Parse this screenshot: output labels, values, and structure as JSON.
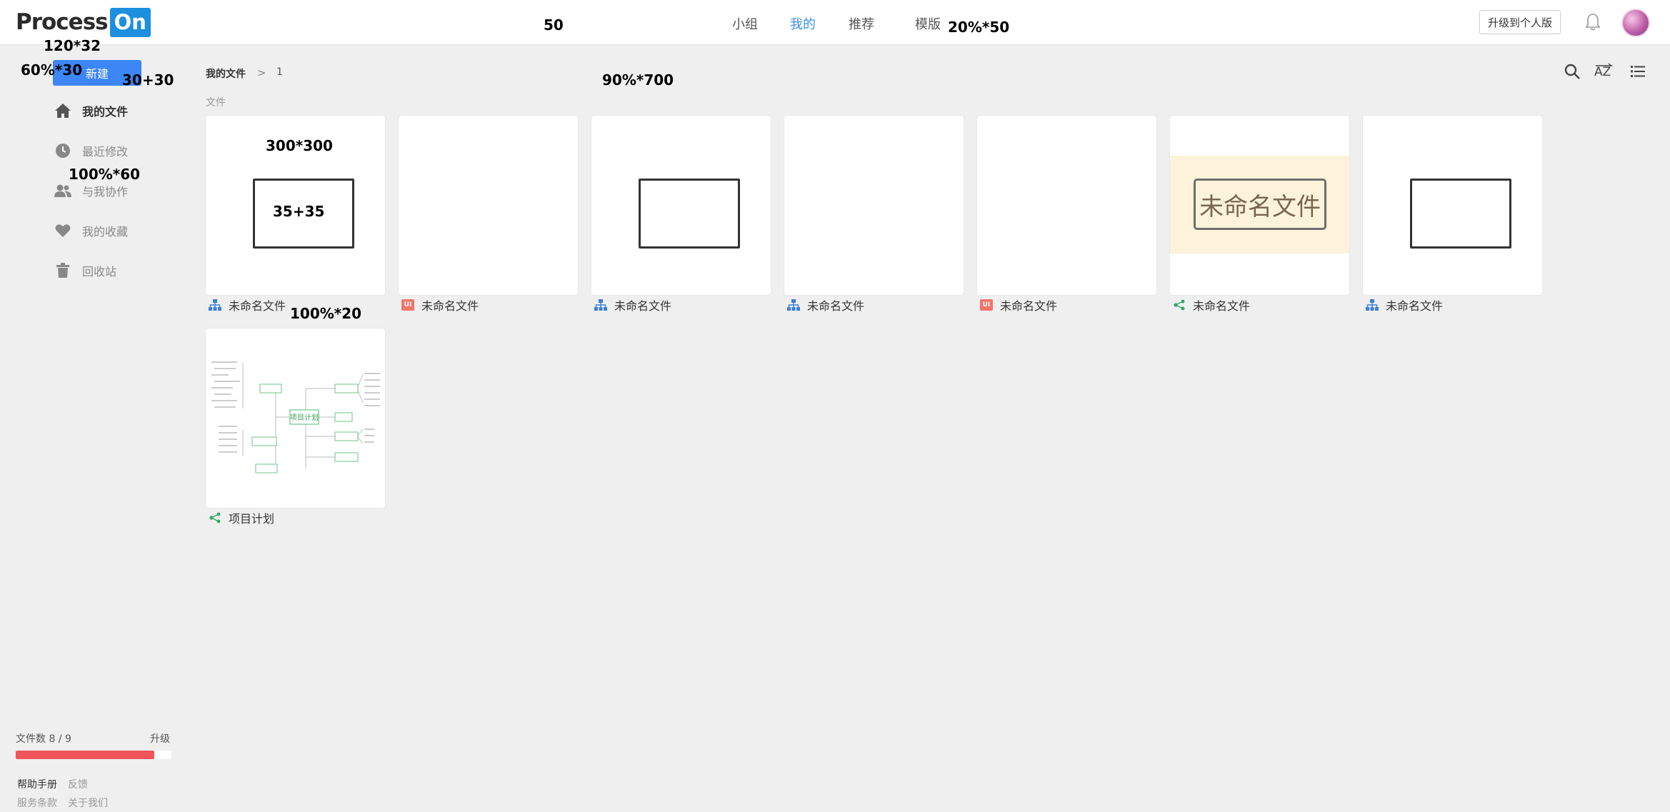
{
  "header": {
    "logo_text": "Process",
    "logo_badge": "On",
    "nav": [
      "小组",
      "我的",
      "推荐",
      "模版"
    ],
    "active_nav": "我的",
    "upgrade_button": "升级到个人版",
    "bell_icon": "bell-icon",
    "avatar": "avatar"
  },
  "annotations": {
    "a1": "50",
    "a2": "20%*50",
    "a3": "120*32",
    "a4": "60%*30",
    "a5": "30+30",
    "a6": "90%*700",
    "a7": "100%*60",
    "a8": "300*300",
    "a9": "35+35",
    "a10": "100%*20"
  },
  "sidebar": {
    "new_button": "新建",
    "items": [
      {
        "label": "我的文件",
        "icon": "home-icon",
        "active": true
      },
      {
        "label": "最近修改",
        "icon": "clock-icon",
        "active": false
      },
      {
        "label": "与我协作",
        "icon": "people-icon",
        "active": false
      },
      {
        "label": "我的收藏",
        "icon": "heart-icon",
        "active": false
      },
      {
        "label": "回收站",
        "icon": "trash-icon",
        "active": false
      }
    ],
    "file_count": "文件数 8 / 9",
    "upgrade": "升级",
    "usage_fraction": 0.89,
    "usage_color": "#f0555a",
    "footer": {
      "help": "帮助手册",
      "feedback": "反馈",
      "terms": "服务条款",
      "about": "关于我们"
    }
  },
  "main": {
    "breadcrumb": {
      "root": "我的文件",
      "sep": ">",
      "current": "1"
    },
    "section": "文件",
    "tools": [
      "search-icon",
      "sort-az-icon",
      "list-view-icon"
    ],
    "files": [
      {
        "name": "未命名文件",
        "type": "flowchart",
        "thumb": "rect"
      },
      {
        "name": "未命名文件",
        "type": "ui",
        "thumb": "blank"
      },
      {
        "name": "未命名文件",
        "type": "flowchart",
        "thumb": "rect"
      },
      {
        "name": "未命名文件",
        "type": "flowchart",
        "thumb": "blank"
      },
      {
        "name": "未命名文件",
        "type": "ui",
        "thumb": "blank"
      },
      {
        "name": "未命名文件",
        "type": "mindmap",
        "thumb": "note",
        "thumb_text": "未命名文件"
      },
      {
        "name": "未命名文件",
        "type": "flowchart",
        "thumb": "rect"
      },
      {
        "name": "项目计划",
        "type": "mindmap",
        "thumb": "mindmap",
        "thumb_text": "项目计划"
      }
    ],
    "ui_badge": "UI"
  }
}
